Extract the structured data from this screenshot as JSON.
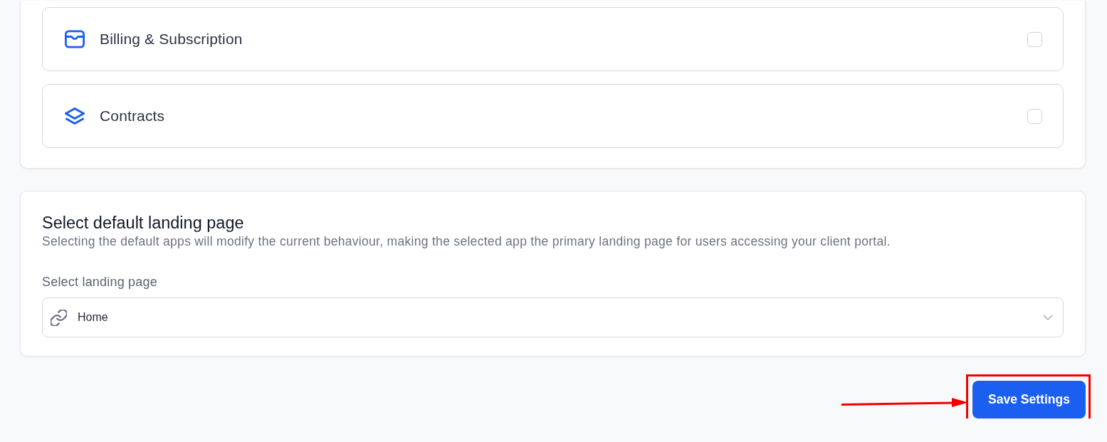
{
  "apps_card": {
    "items": [
      {
        "label": "Billing & Subscription",
        "checked": false
      },
      {
        "label": "Contracts",
        "checked": false
      }
    ]
  },
  "landing_card": {
    "title": "Select default landing page",
    "description": "Selecting the default apps will modify the current behaviour, making the selected app the primary landing page for users accessing your client portal.",
    "field_label": "Select landing page",
    "select": {
      "value": "Home"
    }
  },
  "save_button": {
    "label": "Save Settings"
  },
  "annotations": {
    "highlight_box": true,
    "arrow": true
  }
}
